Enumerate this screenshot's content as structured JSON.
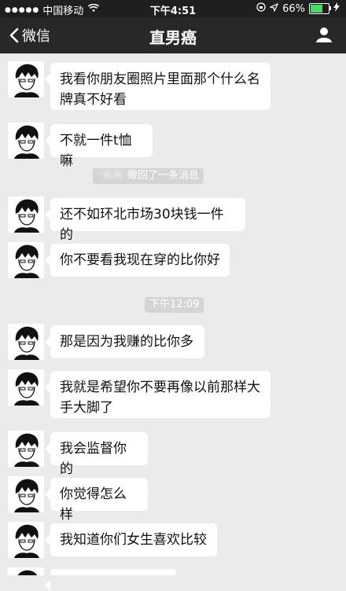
{
  "status_bar": {
    "carrier": "中国移动",
    "time": "下午4:51",
    "battery": "66%",
    "battery_level": 0.66
  },
  "nav": {
    "back_label": "微信",
    "title": "直男癌"
  },
  "messages": [
    "我看你朋友圈照片里面那个什么名牌真不好看",
    "不就一件t恤嘛",
    "还不如环北市场30块钱一件的",
    "你不要看我现在穿的比你好",
    "那是因为我赚的比你多",
    "我就是希望你不要再像以前那样大手大脚了",
    "我会监督你的",
    "你觉得怎么样",
    "我知道你们女生喜欢比较"
  ],
  "system": {
    "recall_name": "\"某某\"",
    "recall_text": "撤回了一条消息",
    "timestamp": "下午12:09"
  }
}
